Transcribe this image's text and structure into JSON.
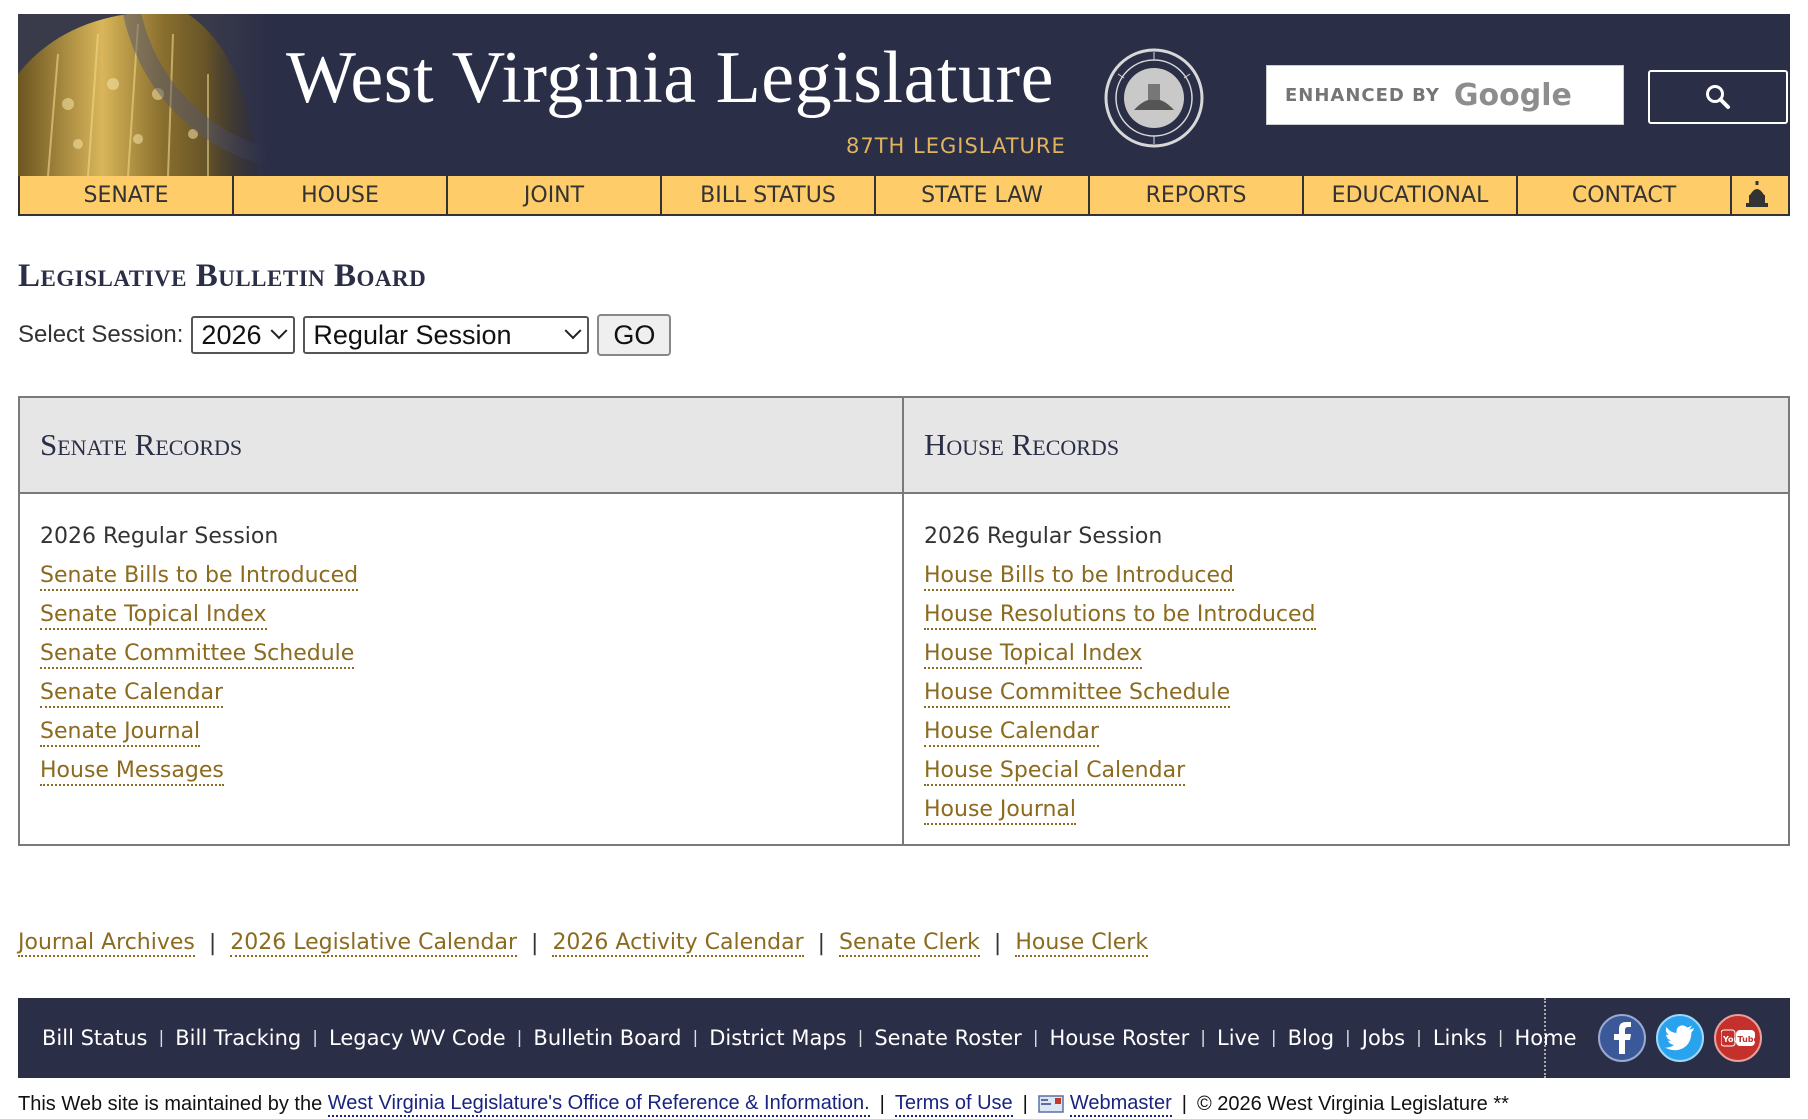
{
  "header": {
    "title": "West Virginia Legislature",
    "subtitle": "87TH LEGISLATURE",
    "search": {
      "enhanced_by": "ENHANCED BY",
      "provider": "Google",
      "placeholder": ""
    }
  },
  "nav": {
    "items": [
      {
        "label": "SENATE"
      },
      {
        "label": "HOUSE"
      },
      {
        "label": "JOINT"
      },
      {
        "label": "BILL STATUS"
      },
      {
        "label": "STATE LAW"
      },
      {
        "label": "REPORTS"
      },
      {
        "label": "EDUCATIONAL"
      },
      {
        "label": "CONTACT"
      }
    ]
  },
  "main": {
    "page_title": "Legislative Bulletin Board",
    "session": {
      "label": "Select Session:",
      "year": "2026",
      "type": "Regular Session",
      "go_label": "GO"
    },
    "senate": {
      "heading": "Senate Records",
      "session": "2026 Regular Session",
      "links": [
        "Senate Bills to be Introduced",
        "Senate Topical Index",
        "Senate Committee Schedule",
        "Senate Calendar",
        "Senate Journal",
        "House Messages"
      ]
    },
    "house": {
      "heading": "House Records",
      "session": "2026 Regular Session",
      "links": [
        "House Bills to be Introduced",
        "House Resolutions to be Introduced",
        "House Topical Index",
        "House Committee Schedule",
        "House Calendar",
        "House Special Calendar",
        "House Journal"
      ]
    },
    "bottom_links": [
      "Journal Archives",
      "2026 Legislative Calendar",
      "2026 Activity Calendar",
      "Senate Clerk",
      "House Clerk"
    ],
    "separator": "|"
  },
  "footer": {
    "links": [
      "Bill Status",
      "Bill Tracking",
      "Legacy WV Code",
      "Bulletin Board",
      "District Maps",
      "Senate Roster",
      "House Roster",
      "Live",
      "Blog",
      "Jobs",
      "Links",
      "Home"
    ],
    "social": [
      "facebook-icon",
      "twitter-icon",
      "youtube-icon"
    ],
    "legal": {
      "prefix": "This Web site is maintained by the",
      "office_link": "West Virginia Legislature's Office of Reference & Information.",
      "terms": "Terms of Use",
      "webmaster": "Webmaster",
      "copyright": "© 2026 West Virginia Legislature **"
    }
  },
  "colors": {
    "navy": "#2b2e47",
    "nav_gold": "#fecc69",
    "link_gold": "#8c6a1e",
    "header_text_gold": "#e0b45c"
  }
}
